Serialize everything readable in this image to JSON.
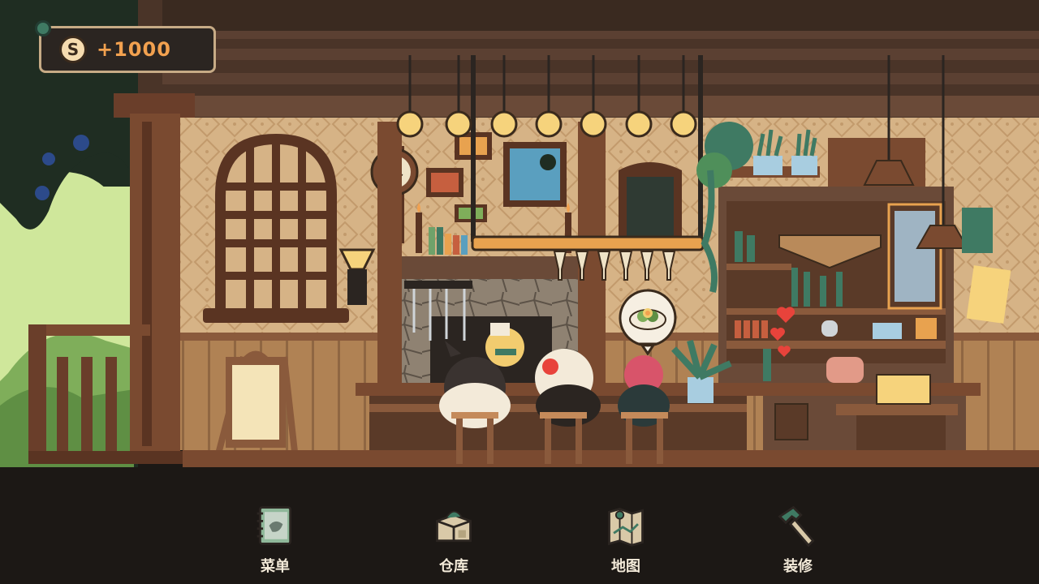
{
  "hud": {
    "currency_symbol": "S",
    "currency_amount": "+1000"
  },
  "menu": [
    {
      "label": "菜单",
      "icon": "recipe-book-icon"
    },
    {
      "label": "仓库",
      "icon": "storage-box-icon"
    },
    {
      "label": "地图",
      "icon": "map-icon"
    },
    {
      "label": "装修",
      "icon": "hammer-icon"
    }
  ],
  "colors": {
    "wall": "#d6b386",
    "wall_pattern": "#c29a6c",
    "wood_dark": "#5a3a28",
    "wood_mid": "#8a5a3c",
    "floor": "#231d19",
    "accent_orange": "#f2a14f",
    "garden_green": "#cfe79b",
    "heart": "#e8433b"
  },
  "scene": {
    "order_bubble_icon": "salad-dish-icon",
    "customers": [
      "cat-customer-white-black",
      "cat-customer-white-flower",
      "red-hat-customer"
    ],
    "chef": "chef-cat-icon"
  }
}
